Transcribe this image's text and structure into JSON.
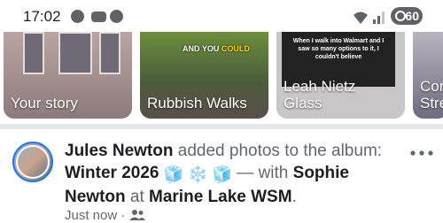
{
  "status_bar": {
    "time": "17:02",
    "battery": "60",
    "icons": [
      "facebook-icon",
      "messenger-icon",
      "facebook-icon",
      "wifi-icon",
      "signal-icon"
    ]
  },
  "stories": [
    {
      "label": "Your story",
      "overlay": ""
    },
    {
      "label": "Rubbish Walks",
      "overlay_prefix": "AND YOU ",
      "overlay_highlight": "COULD"
    },
    {
      "label": "Leah Nietz Glass",
      "overlay": "When I walk into Walmart and I saw so many options to it, I couldn't believe"
    },
    {
      "label": "Cor Stre",
      "overlay": ""
    }
  ],
  "post": {
    "author": "Jules Newton",
    "action": " added photos to the album: ",
    "album": "Winter 2026",
    "emojis": "🧊 ❄️ 🧊",
    "with_text": " — with ",
    "tagged": "Sophie Newton",
    "at_text": " at ",
    "place": "Marine Lake WSM",
    "end": ".",
    "time": "Just now",
    "separator": "·",
    "privacy_icon": "friends-icon",
    "more_icon": "more-options-icon"
  },
  "colors": {
    "accent": "#1877f2",
    "text": "#1c1e21",
    "muted": "#65676b",
    "divider": "#e4e6eb"
  }
}
